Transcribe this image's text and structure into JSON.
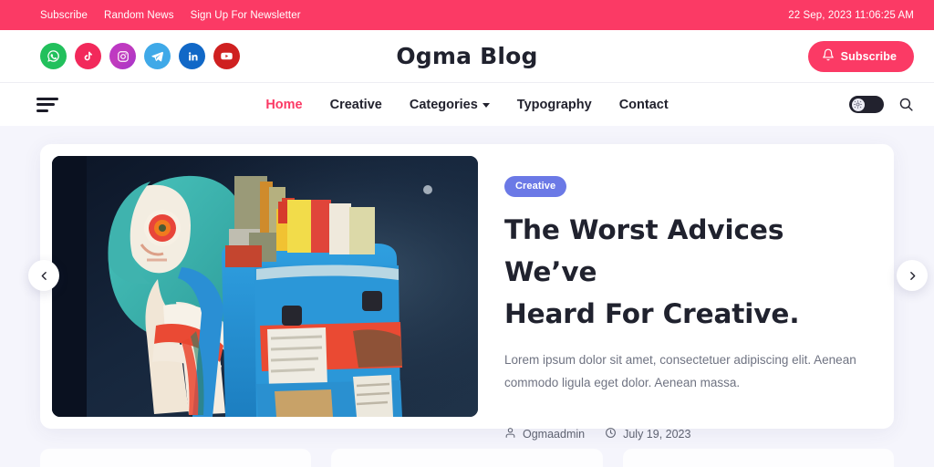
{
  "topbar": {
    "links": [
      {
        "label": "Subscribe",
        "name": "topbar-link-subscribe"
      },
      {
        "label": "Random News",
        "name": "topbar-link-random-news"
      },
      {
        "label": "Sign Up For Newsletter",
        "name": "topbar-link-newsletter"
      }
    ],
    "datetime": "22 Sep, 2023 11:06:25 AM"
  },
  "header": {
    "brand": "Ogma Blog",
    "subscribe_label": "Subscribe",
    "socials": [
      {
        "name": "whatsapp-icon",
        "label": "WhatsApp",
        "color": "#22c05c"
      },
      {
        "name": "tiktok-icon",
        "label": "TikTok",
        "color": "#f2295b"
      },
      {
        "name": "instagram-icon",
        "label": "Instagram",
        "color": "#b936c9"
      },
      {
        "name": "telegram-icon",
        "label": "Telegram",
        "color": "#3fa9e8"
      },
      {
        "name": "linkedin-icon",
        "label": "LinkedIn",
        "color": "#1168c7"
      },
      {
        "name": "youtube-icon",
        "label": "YouTube",
        "color": "#cf2020"
      }
    ]
  },
  "nav": {
    "items": [
      {
        "label": "Home",
        "active": true,
        "dropdown": false
      },
      {
        "label": "Creative",
        "active": false,
        "dropdown": false
      },
      {
        "label": "Categories",
        "active": false,
        "dropdown": true
      },
      {
        "label": "Typography",
        "active": false,
        "dropdown": false
      },
      {
        "label": "Contact",
        "active": false,
        "dropdown": false
      }
    ],
    "menu_icon": "hamburger-icon",
    "mode_toggle": "dark-mode-toggle",
    "search_icon": "search-icon"
  },
  "hero": {
    "category": "Creative",
    "title": "The Worst Advices We’ve Heard For Creative.",
    "title_line1": "The Worst Advices We’ve",
    "title_line2": "Heard For Creative.",
    "excerpt": "Lorem ipsum dolor sit amet, consectetuer adipiscing elit. Aenean commodo ligula eget dolor. Aenean massa.",
    "author": "Ogmaadmin",
    "date": "July 19, 2023",
    "image_alt": "Illustration of a girl with teal hair carrying a blue backpack full of books at night",
    "prev_icon": "chevron-left-icon",
    "next_icon": "chevron-right-icon"
  },
  "colors": {
    "accent_pink": "#fb3a65",
    "badge_indigo": "#6b79e6",
    "page_background": "#f5f5fc",
    "text_dark": "#20222e",
    "text_muted": "#6f7382"
  }
}
